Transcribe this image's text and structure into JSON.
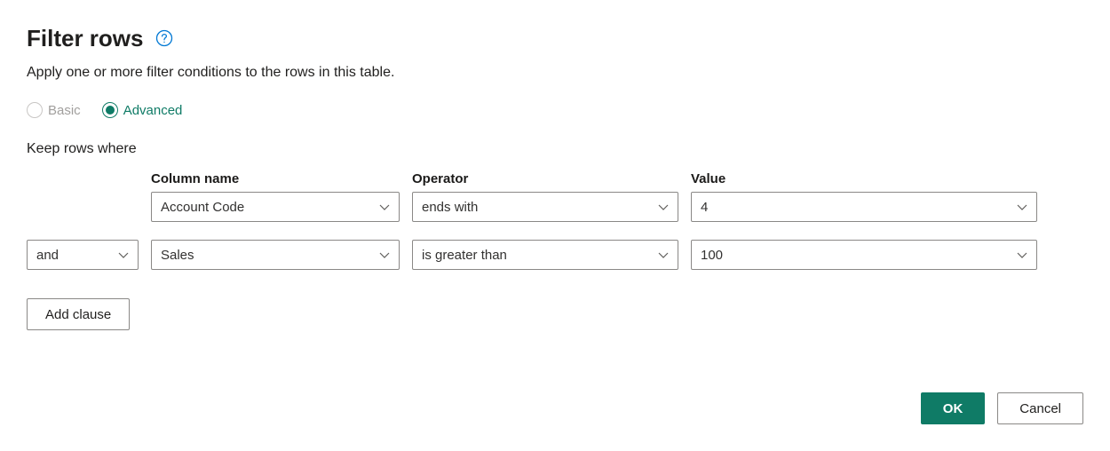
{
  "header": {
    "title": "Filter rows",
    "subtitle": "Apply one or more filter conditions to the rows in this table."
  },
  "mode": {
    "basic_label": "Basic",
    "advanced_label": "Advanced",
    "selected": "advanced"
  },
  "filters": {
    "keep_label": "Keep rows where",
    "col_header_column": "Column name",
    "col_header_operator": "Operator",
    "col_header_value": "Value",
    "rows": [
      {
        "conjunction": "",
        "column": "Account Code",
        "operator": "ends with",
        "value": "4"
      },
      {
        "conjunction": "and",
        "column": "Sales",
        "operator": "is greater than",
        "value": "100"
      }
    ],
    "add_clause_label": "Add clause"
  },
  "footer": {
    "ok_label": "OK",
    "cancel_label": "Cancel"
  }
}
